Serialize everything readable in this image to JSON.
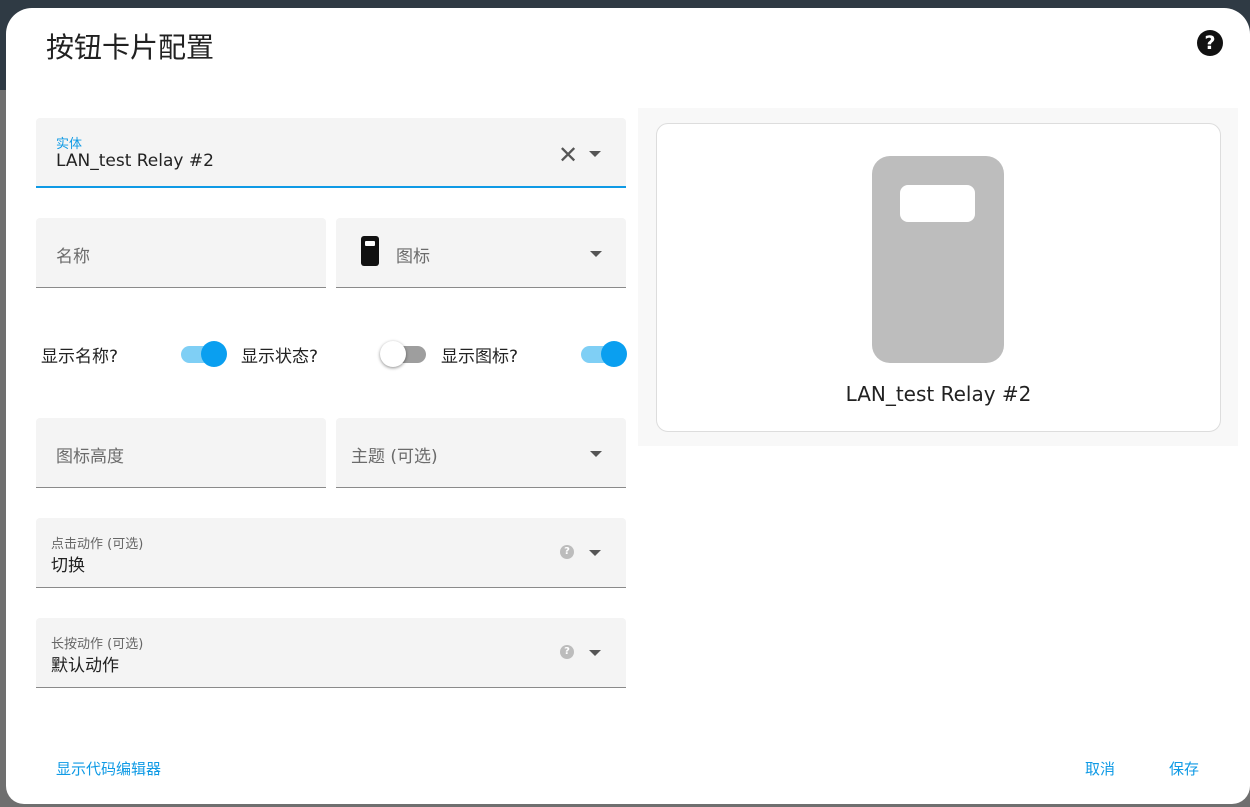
{
  "dialog": {
    "title": "按钮卡片配置",
    "help_glyph": "?"
  },
  "entity": {
    "label": "实体",
    "value": "LAN_test Relay #2",
    "clear_glyph": "✕"
  },
  "name_field": {
    "placeholder": "名称"
  },
  "icon_field": {
    "placeholder": "图标"
  },
  "toggles": {
    "show_name": {
      "label": "显示名称?",
      "checked": true
    },
    "show_state": {
      "label": "显示状态?",
      "checked": false
    },
    "show_icon": {
      "label": "显示图标?",
      "checked": true
    }
  },
  "icon_height_field": {
    "placeholder": "图标高度"
  },
  "theme_field": {
    "placeholder": "主题 (可选)"
  },
  "tap_action": {
    "label": "点击动作 (可选)",
    "value": "切换"
  },
  "hold_action": {
    "label": "长按动作 (可选)",
    "value": "默认动作"
  },
  "preview": {
    "entity_name": "LAN_test Relay #2",
    "icon": "door-icon"
  },
  "footer": {
    "code_editor_label": "显示代码编辑器",
    "cancel_label": "取消",
    "save_label": "保存"
  },
  "colors": {
    "accent": "#0f9ae5",
    "toggle_on": "#0a9ff0",
    "field_bg": "#f4f4f4",
    "preview_icon": "#bdbdbd"
  }
}
